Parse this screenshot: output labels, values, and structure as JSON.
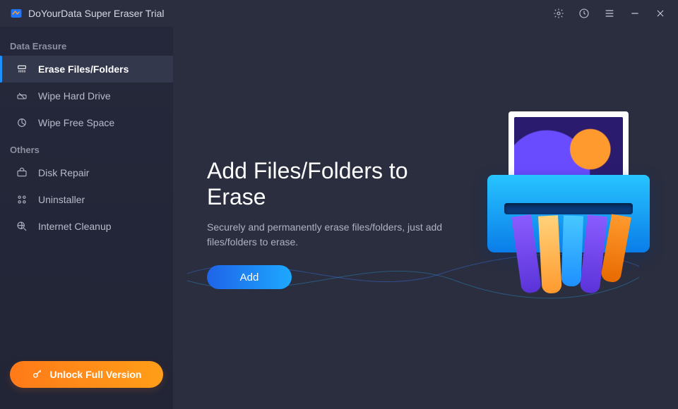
{
  "app": {
    "title": "DoYourData Super Eraser Trial"
  },
  "controls": {
    "settings_icon": "gear-icon",
    "history_icon": "clock-icon",
    "menu_icon": "menu-icon",
    "min_icon": "minimize-icon",
    "close_icon": "close-icon"
  },
  "sidebar": {
    "section1_title": "Data Erasure",
    "section1_items": [
      {
        "label": "Erase Files/Folders",
        "icon": "shredder-icon",
        "active": true
      },
      {
        "label": "Wipe Hard Drive",
        "icon": "drive-erase-icon",
        "active": false
      },
      {
        "label": "Wipe Free Space",
        "icon": "pie-icon",
        "active": false
      }
    ],
    "section2_title": "Others",
    "section2_items": [
      {
        "label": "Disk Repair",
        "icon": "toolbox-icon"
      },
      {
        "label": "Uninstaller",
        "icon": "grid-icon"
      },
      {
        "label": "Internet Cleanup",
        "icon": "globe-broom-icon"
      }
    ],
    "unlock_label": "Unlock Full Version"
  },
  "main": {
    "heading": "Add Files/Folders to Erase",
    "description": "Securely and permanently erase files/folders, just add files/folders to erase.",
    "add_label": "Add"
  },
  "colors": {
    "accent_blue": "#1e90ff",
    "accent_orange": "#ff7a18",
    "bg": "#2a2e3f",
    "sidebar": "#232639"
  }
}
